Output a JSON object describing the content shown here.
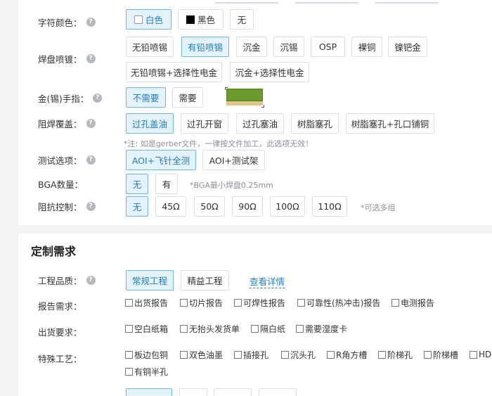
{
  "char_color": {
    "label": "字符颜色：",
    "options": [
      "白色",
      "黑色",
      "无"
    ],
    "selected": "白色"
  },
  "pad_finish": {
    "label": "焊盘喷镀：",
    "options_row1": [
      "无铅喷锡",
      "有铅喷锡",
      "沉金",
      "沉锡",
      "OSP",
      "裸铜",
      "镍钯金"
    ],
    "options_row2": [
      "无铅喷锡+选择性电金",
      "沉金+选择性电金"
    ],
    "selected": "有铅喷锡"
  },
  "gold_finger": {
    "label": "金(锡)手指：",
    "options": [
      "不需要",
      "需要"
    ],
    "selected": "不需要",
    "image_icon": "gold-finger-preview-icon"
  },
  "solder_mask_cover": {
    "label": "阻焊覆盖：",
    "options": [
      "过孔盖油",
      "过孔开窗",
      "过孔塞油",
      "树脂塞孔",
      "树脂塞孔+孔口铺铜"
    ],
    "selected": "过孔盖油",
    "note": "*注: 如是gerber文件，一律按文件加工，此选项无效！"
  },
  "test_option": {
    "label": "测试选项：",
    "options": [
      "AOI+飞针全测",
      "AOI+测试架"
    ],
    "selected": "AOI+飞针全测"
  },
  "bga_count": {
    "label": "BGA数量：",
    "options": [
      "无",
      "有"
    ],
    "selected": "无",
    "note": "*BGA最小焊盘0.25mm"
  },
  "impedance": {
    "label": "阻抗控制：",
    "options": [
      "无",
      "45Ω",
      "50Ω",
      "90Ω",
      "100Ω",
      "110Ω"
    ],
    "selected": "无",
    "note": "*可选多组"
  },
  "custom_section": {
    "title": "定制需求"
  },
  "engineering_grade": {
    "label": "工程品质：",
    "options": [
      "常规工程",
      "精益工程"
    ],
    "selected": "常规工程",
    "link": "查看详情"
  },
  "report_req": {
    "label": "报告需求：",
    "options": [
      "出货报告",
      "切片报告",
      "可焊性报告",
      "可靠性(热冲击)报告",
      "电测报告"
    ]
  },
  "ship_req": {
    "label": "出货要求：",
    "options": [
      "空白纸箱",
      "无抬头发货单",
      "隔白纸",
      "需要湿度卡"
    ]
  },
  "special_process": {
    "label": "特殊工艺：",
    "options_row1": [
      "板边包铜",
      "双色油墨",
      "插接孔",
      "沉头孔",
      "R角方槽",
      "阶梯孔",
      "阶梯槽",
      "HD"
    ],
    "options_row2": [
      "有铜半孔"
    ]
  },
  "colors": {
    "accent": "#1f7fc4",
    "selected_bg": "#e3f2fb",
    "selected_border": "#6cb7e6",
    "page_bg": "#f2f3f5"
  }
}
